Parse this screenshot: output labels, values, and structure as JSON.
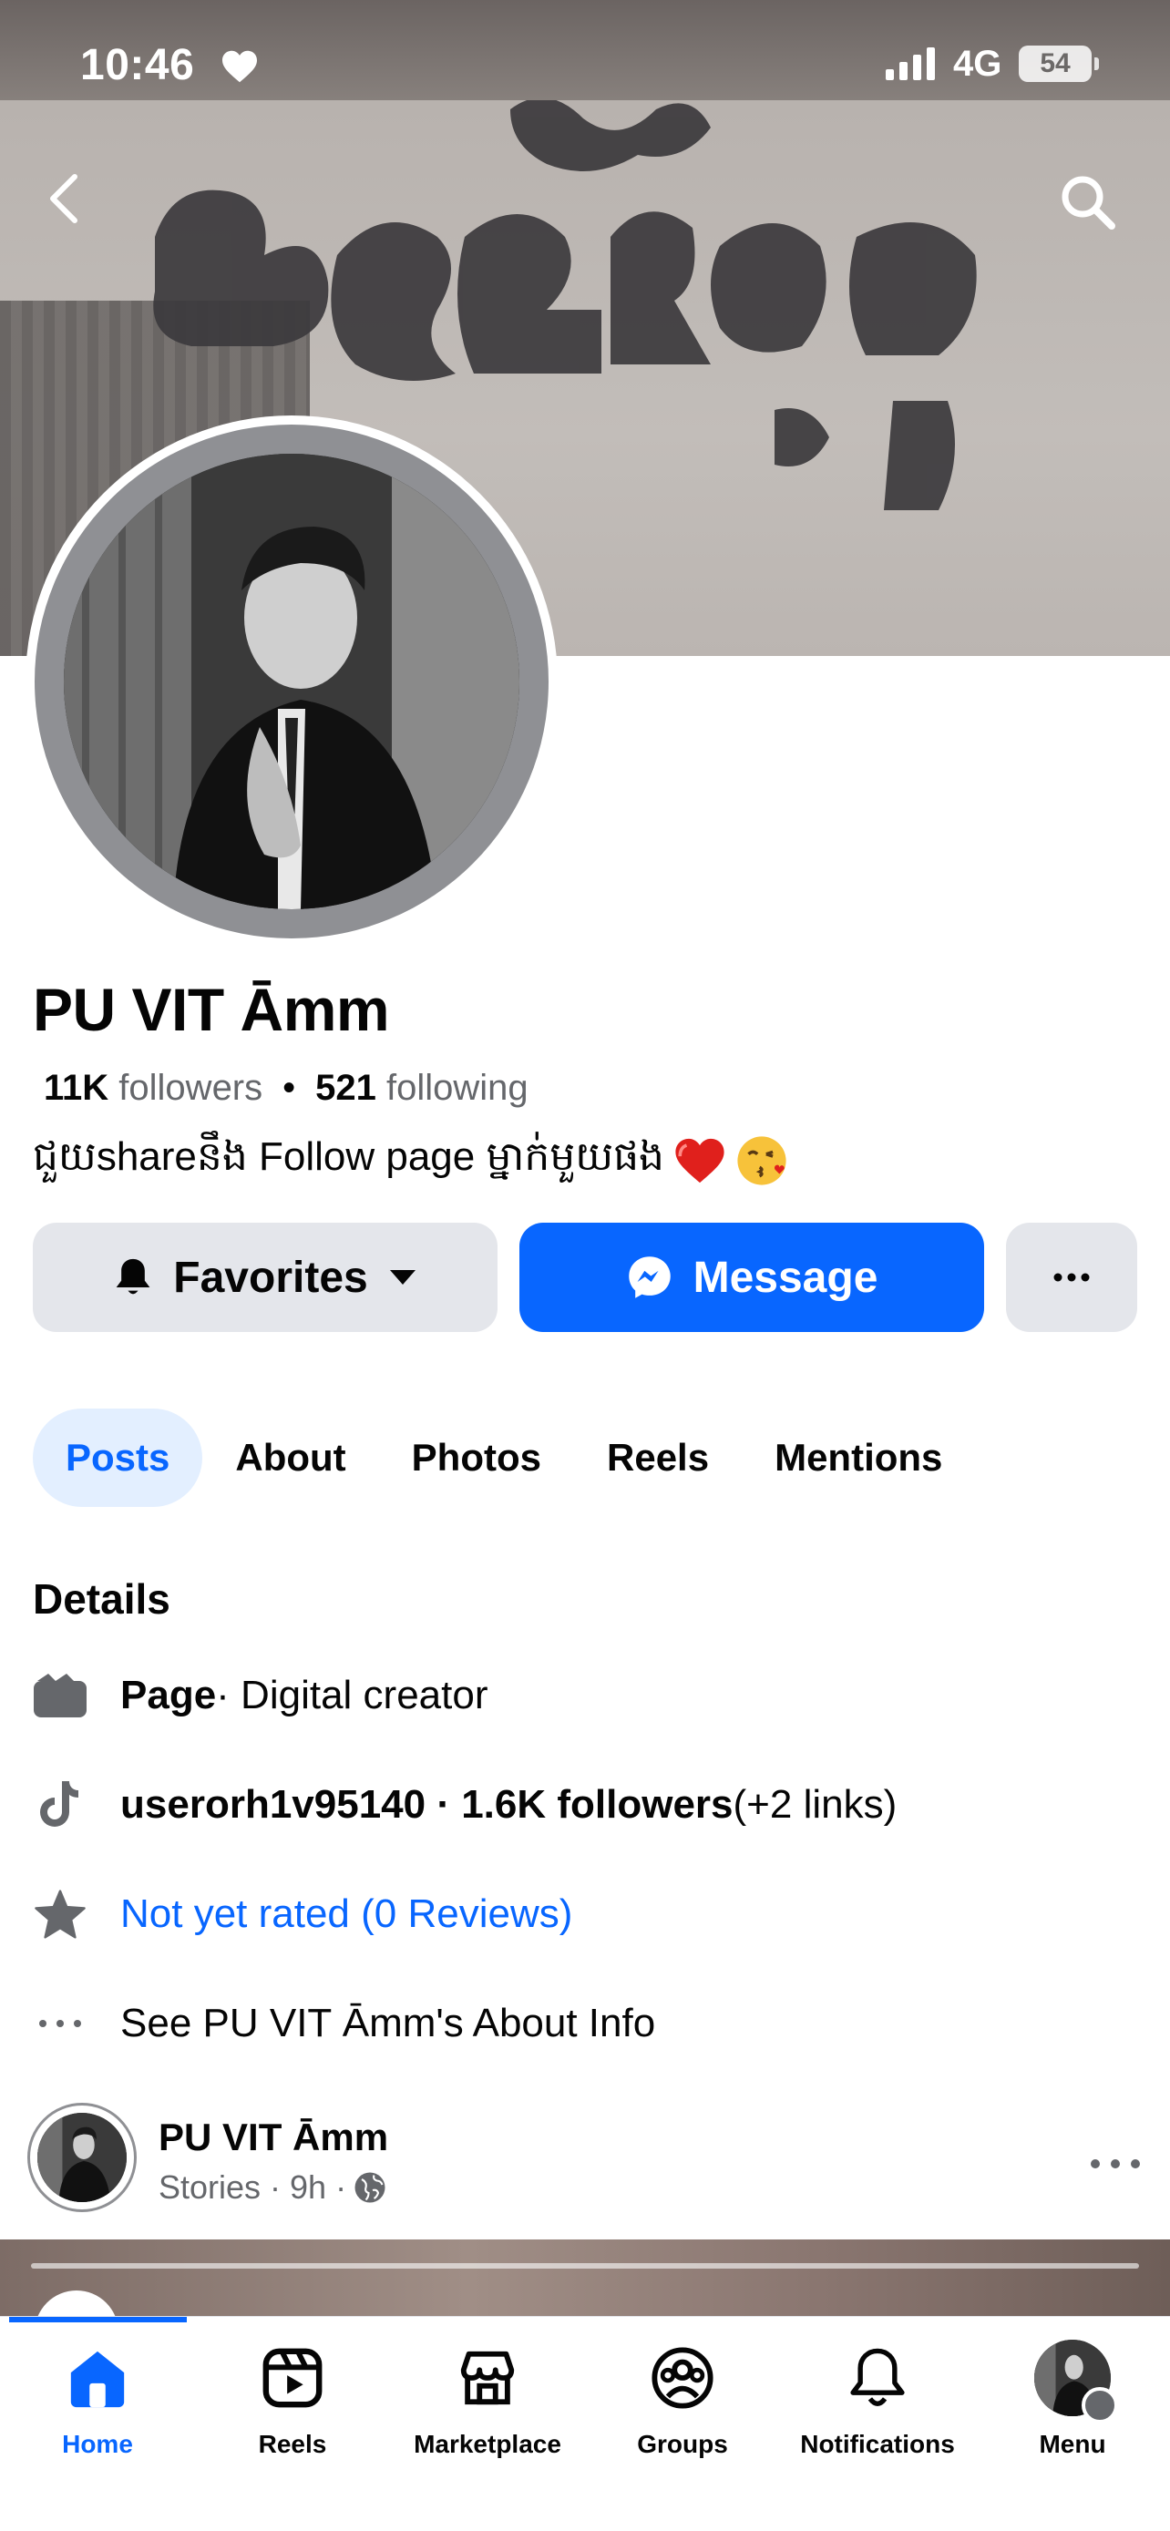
{
  "status_bar": {
    "time": "10:46",
    "network": "4G",
    "battery": "54"
  },
  "header": {
    "back_icon": "chevron-left-icon",
    "search_icon": "search-icon"
  },
  "profile": {
    "name": "PU VIT Āmm",
    "followers_count": "11K",
    "followers_label": "followers",
    "following_count": "521",
    "following_label": "following",
    "bio": "ជួយshareនឹង Follow page ម្នាក់មួយផង"
  },
  "actions": {
    "favorites_label": "Favorites",
    "message_label": "Message"
  },
  "tabs": [
    {
      "label": "Posts",
      "active": true
    },
    {
      "label": "About"
    },
    {
      "label": "Photos"
    },
    {
      "label": "Reels"
    },
    {
      "label": "Mentions"
    }
  ],
  "details": {
    "title": "Details",
    "page_bold": "Page",
    "page_rest": " · Digital creator",
    "tiktok_bold": "userorh1v95140 · 1.6K followers",
    "tiktok_rest": " (+2 links)",
    "rating": "Not yet rated (0 Reviews)",
    "about": "See PU VIT Āmm's About Info"
  },
  "post": {
    "author": "PU VIT Āmm",
    "meta": "Stories · 9h ·"
  },
  "bottom_nav": [
    {
      "label": "Home",
      "icon": "home-icon",
      "active": true
    },
    {
      "label": "Reels",
      "icon": "reels-icon"
    },
    {
      "label": "Marketplace",
      "icon": "marketplace-icon"
    },
    {
      "label": "Groups",
      "icon": "groups-icon"
    },
    {
      "label": "Notifications",
      "icon": "bell-icon"
    },
    {
      "label": "Menu",
      "icon": "menu-avatar"
    }
  ],
  "colors": {
    "accent": "#0866ff",
    "secondary_button": "#e4e6eb",
    "muted_text": "#65676b",
    "active_tab_bg": "#e3efff"
  }
}
